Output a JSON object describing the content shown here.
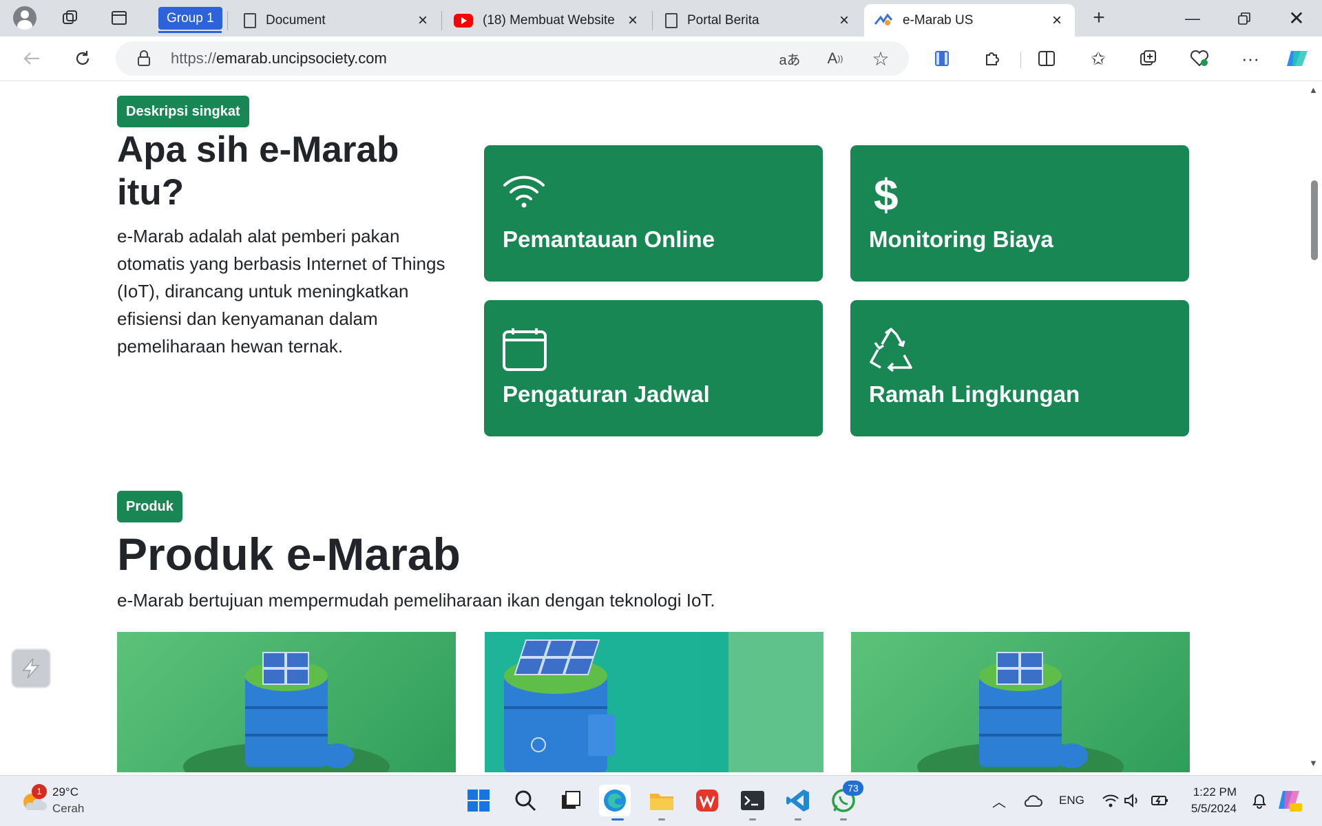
{
  "browser": {
    "group_label": "Group 1",
    "tabs": [
      {
        "title": "Document",
        "icon": "document-icon",
        "active": false
      },
      {
        "title": "(18) Membuat Website",
        "icon": "youtube-icon",
        "active": false
      },
      {
        "title": "Portal Berita",
        "icon": "document-icon",
        "active": false
      },
      {
        "title": "e-Marab US",
        "icon": "site-favicon",
        "active": true
      }
    ],
    "url_prefix": "https://",
    "url_domain": "emarab.uncipsociety.com"
  },
  "about": {
    "badge": "Deskripsi singkat",
    "title": "Apa sih e-Marab itu?",
    "description": "e-Marab adalah alat pemberi pakan otomatis yang berbasis Internet of Things (IoT), dirancang untuk meningkatkan efisiensi dan kenyamanan dalam pemeliharaan hewan ternak."
  },
  "features": [
    {
      "label": "Pemantauan Online",
      "icon": "wifi-icon"
    },
    {
      "label": "Monitoring Biaya",
      "icon": "dollar-icon"
    },
    {
      "label": "Pengaturan Jadwal",
      "icon": "calendar-icon"
    },
    {
      "label": "Ramah Lingkungan",
      "icon": "recycle-icon"
    }
  ],
  "products": {
    "badge": "Produk",
    "title": "Produk e-Marab",
    "subtitle": "e-Marab bertujuan mempermudah pemeliharaan ikan dengan teknologi IoT."
  },
  "colors": {
    "accent": "#198754",
    "tab_group": "#2e62d9"
  },
  "taskbar": {
    "weather_temp": "29°C",
    "weather_desc": "Cerah",
    "weather_badge": "1",
    "whatsapp_badge": "73",
    "language": "ENG",
    "time": "1:22 PM",
    "date": "5/5/2024"
  }
}
